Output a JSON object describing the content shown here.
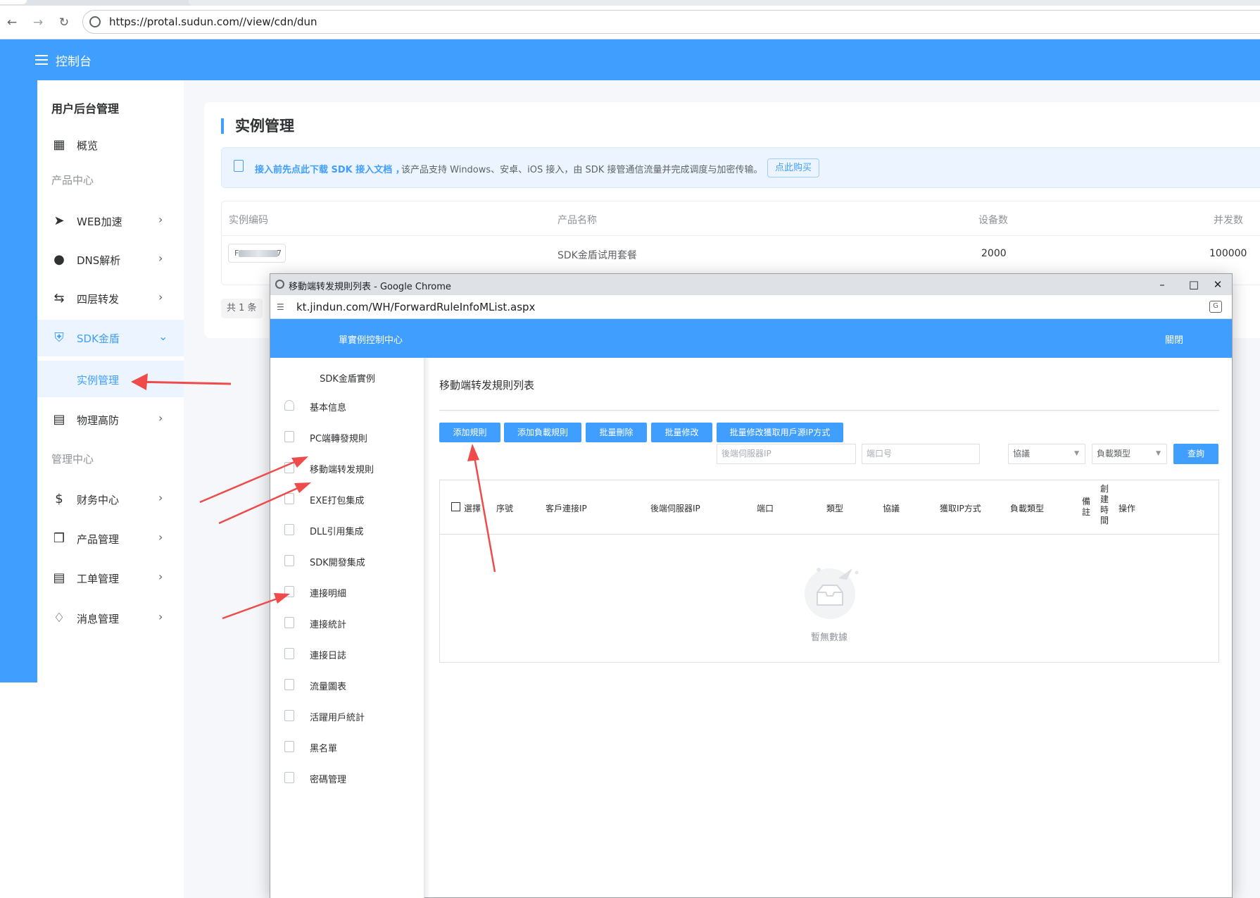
{
  "browser": {
    "url": "https://protal.sudun.com//view/cdn/dun",
    "back_icon": "back-arrow-icon",
    "forward_icon": "forward-arrow-icon",
    "reload_icon": "reload-icon"
  },
  "header": {
    "title": "控制台"
  },
  "sidebar": {
    "title": "用户后台管理",
    "overview": "概览",
    "group_product": "产品中心",
    "items": [
      {
        "label": "WEB加速"
      },
      {
        "label": "DNS解析"
      },
      {
        "label": "四层转发"
      },
      {
        "label": "SDK金盾"
      },
      {
        "label": "实例管理"
      },
      {
        "label": "物理高防"
      }
    ],
    "group_manage": "管理中心",
    "manage_items": [
      {
        "label": "财务中心"
      },
      {
        "label": "产品管理"
      },
      {
        "label": "工单管理"
      },
      {
        "label": "消息管理"
      }
    ]
  },
  "main": {
    "title": "实例管理",
    "notice_link": "接入前先点此下载 SDK 接入文档 ，",
    "notice_text": "该产品支持 Windows、安卓、iOS 接入，由 SDK 接管通信流量并完成调度与加密传输。",
    "buy_button": "点此购买",
    "table": {
      "headers": [
        "实例编码",
        "产品名称",
        "设备数",
        "并发数"
      ],
      "row": {
        "code_prefix": "F",
        "code_suffix": "7",
        "product": "SDK金盾试用套餐",
        "devices": "2000",
        "concurrency": "100000"
      }
    },
    "pager": "共 1 条"
  },
  "popup": {
    "window_title": "移動端转发規則列表 - Google Chrome",
    "url": "kt.jindun.com/WH/ForwardRuleInfoMList.aspx",
    "header_left": "單實例控制中心",
    "header_right": "關閉",
    "sidebar_title": "SDK金盾實例",
    "sidebar_items": [
      "基本信息",
      "PC端轉發規則",
      "移動端转发規則",
      "EXE打包集成",
      "DLL引用集成",
      "SDK開發集成",
      "連接明細",
      "連接統計",
      "連接日誌",
      "流量圖表",
      "活躍用戶統計",
      "黑名單",
      "密碼管理"
    ],
    "page_title": "移動端转发規則列表",
    "buttons": [
      "添加規則",
      "添加負載規則",
      "批量刪除",
      "批量修改",
      "批量修改獲取用戶源IP方式"
    ],
    "filters": {
      "backend_ip_placeholder": "後端伺服器IP",
      "port_placeholder": "端口号",
      "protocol": "協議",
      "load_type": "負載類型",
      "query": "查詢"
    },
    "table_headers": [
      "選擇",
      "序號",
      "客戶連接IP",
      "後端伺服器IP",
      "端口",
      "類型",
      "協議",
      "獲取IP方式",
      "負載類型",
      "備註",
      "創建時間",
      "操作"
    ],
    "empty_text": "暫無數據"
  },
  "colors": {
    "primary": "#409eff",
    "arrow": "#f04b4b"
  }
}
